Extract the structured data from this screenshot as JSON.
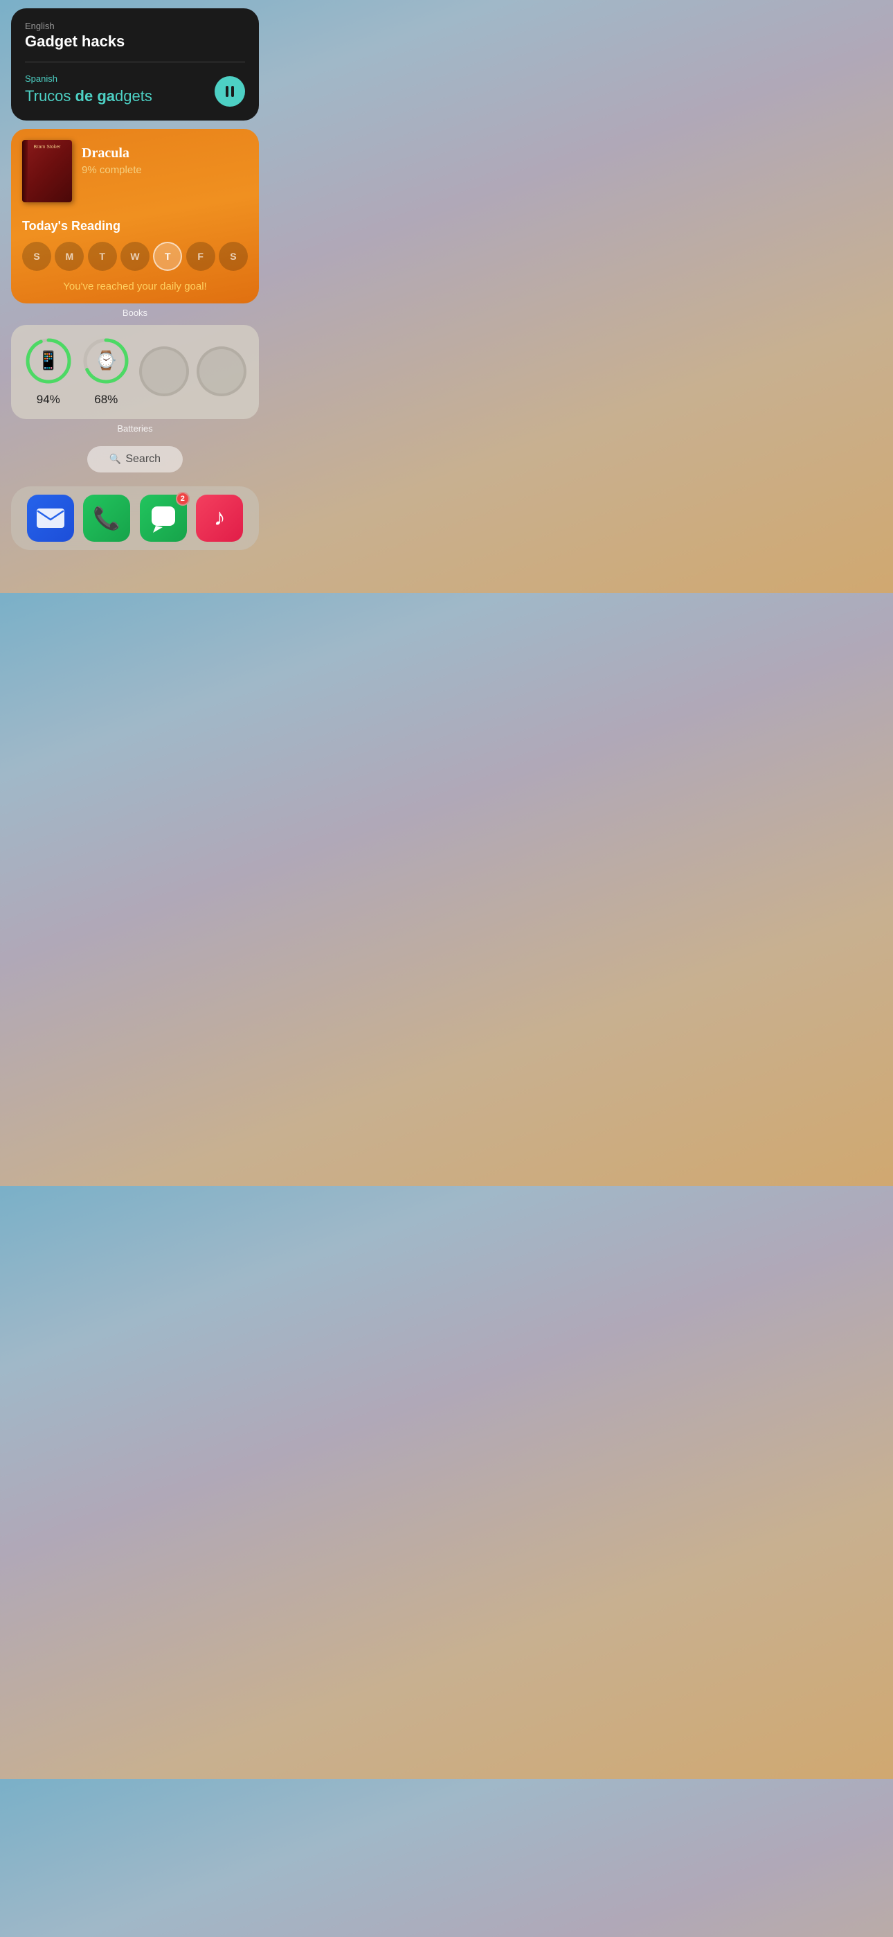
{
  "translation": {
    "source_lang": "English",
    "source_text": "Gadget hacks",
    "dest_lang": "Spanish",
    "dest_text_plain": "Trucos",
    "dest_text_bold": " de ga",
    "dest_text_rest": "dgets",
    "pause_label": "pause"
  },
  "books": {
    "book_title": "Dracula",
    "book_author": "Bram Stoker",
    "book_progress": "9% complete",
    "section_label": "Today's Reading",
    "days": [
      "S",
      "M",
      "T",
      "W",
      "T",
      "F",
      "S"
    ],
    "active_day_index": 4,
    "goal_text": "You've reached your daily goal!",
    "widget_label": "Books"
  },
  "batteries": {
    "widget_label": "Batteries",
    "devices": [
      {
        "type": "phone",
        "percent": 94,
        "show": true
      },
      {
        "type": "watch",
        "percent": 68,
        "show": true
      },
      {
        "type": "empty",
        "percent": 0,
        "show": false
      },
      {
        "type": "empty",
        "percent": 0,
        "show": false
      }
    ]
  },
  "search": {
    "label": "Search"
  },
  "dock": {
    "apps": [
      {
        "name": "Mail",
        "type": "mail",
        "badge": null
      },
      {
        "name": "Phone",
        "type": "phone",
        "badge": null
      },
      {
        "name": "Messages",
        "type": "messages",
        "badge": 2
      },
      {
        "name": "Music",
        "type": "music",
        "badge": null
      }
    ]
  }
}
